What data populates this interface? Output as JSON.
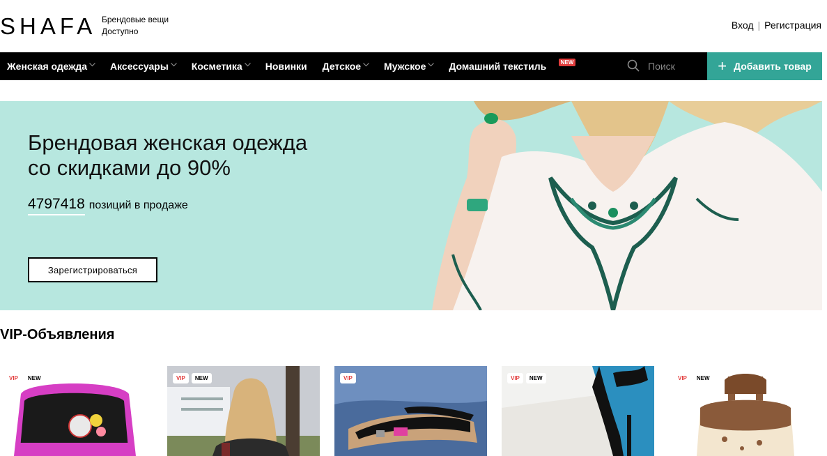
{
  "header": {
    "logo": "SHAFA",
    "tagline_line1": "Брендовые вещи",
    "tagline_line2": "Доступно",
    "login": "Вход",
    "register": "Регистрация"
  },
  "nav": {
    "items": [
      {
        "label": "Женская одежда",
        "dropdown": true
      },
      {
        "label": "Аксессуары",
        "dropdown": true
      },
      {
        "label": "Косметика",
        "dropdown": true
      },
      {
        "label": "Новинки",
        "dropdown": false
      },
      {
        "label": "Детское",
        "dropdown": true
      },
      {
        "label": "Мужское",
        "dropdown": true
      },
      {
        "label": "Домашний текстиль",
        "dropdown": false,
        "badge": "NEW"
      }
    ],
    "search_placeholder": "Поиск",
    "add_button": "Добавить товар"
  },
  "hero": {
    "title_line1": "Брендовая женская одежда",
    "title_line2": "со скидками до 90%",
    "count": "4797418",
    "count_suffix": "позиций в продаже",
    "register_button": "Зарегистрироваться"
  },
  "vip": {
    "title": "VIP-Объявления",
    "cards": [
      {
        "vip": "VIP",
        "new": "NEW",
        "image": "backpack-with-badges"
      },
      {
        "vip": "VIP",
        "new": "NEW",
        "image": "woman-long-hair"
      },
      {
        "vip": "VIP",
        "new": "",
        "image": "sandals-on-jeans"
      },
      {
        "vip": "VIP",
        "new": "NEW",
        "image": "black-heels-in-box"
      },
      {
        "vip": "VIP",
        "new": "NEW",
        "image": "printed-canvas-backpack"
      }
    ]
  },
  "colors": {
    "accent": "#33a597",
    "hero_bg": "#b7e7df",
    "nav_bg": "#000000",
    "vip_red": "#e23d3d"
  }
}
